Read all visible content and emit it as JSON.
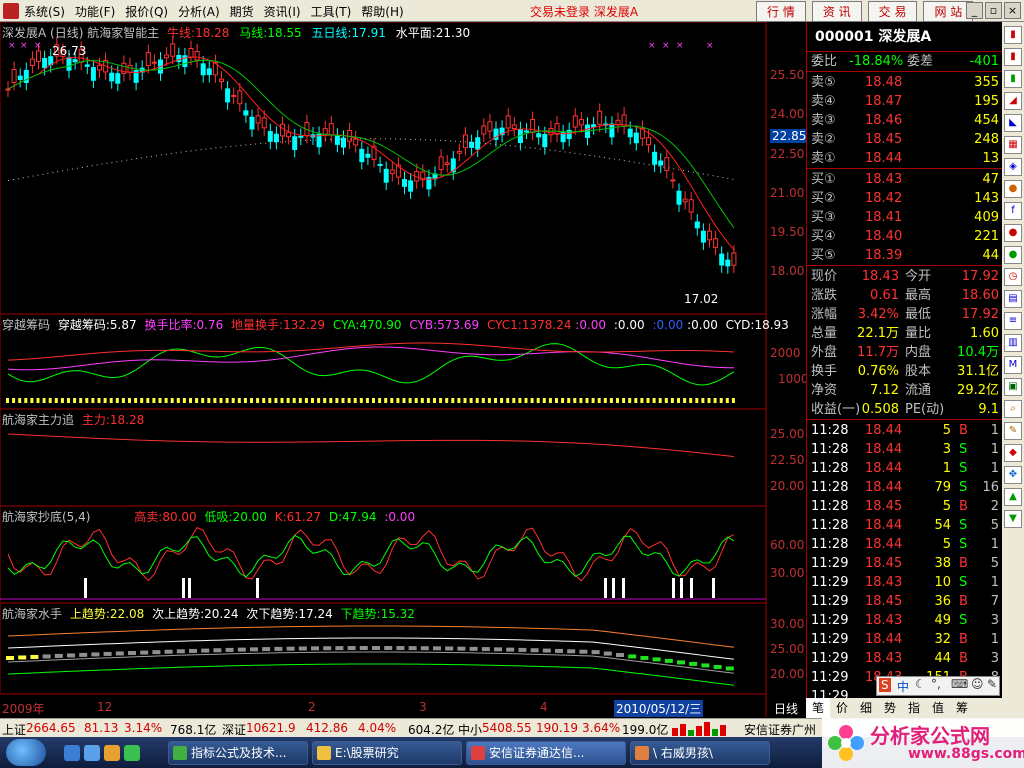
{
  "menubar": {
    "items": [
      "系统(S)",
      "功能(F)",
      "报价(Q)",
      "分析(A)",
      "期货",
      "资讯(I)",
      "工具(T)",
      "帮助(H)"
    ],
    "status": "交易未登录  深发展A",
    "buttons": [
      "行 情",
      "资 讯",
      "交 易",
      "网 站"
    ]
  },
  "chart": {
    "main_title": "深发展A (日线) 航海家智能主",
    "ma_labels": [
      "牛线:18.28",
      "马线:18.55",
      "五日线:17.91",
      "水平面:21.30"
    ],
    "high_label": "26.73",
    "low_label": "17.02",
    "price_marker": "22.85",
    "price_axis": [
      "25.50",
      "24.00",
      "22.50",
      "21.00",
      "19.50",
      "18.00"
    ],
    "p2_title": "穿越筹码",
    "p2_labels": [
      "穿越筹码:5.87",
      "换手比率:0.76",
      "地量换手:132.29",
      "CYA:470.90",
      "CYB:573.69",
      "CYC1:1378.24",
      ":0.00",
      ":0.00",
      ":0.00",
      ":0.00",
      "CYD:18.93"
    ],
    "p2_axis": [
      "2000",
      "1000"
    ],
    "p3_title": "航海家主力追",
    "p3_labels": [
      "主力:18.28"
    ],
    "p3_axis": [
      "25.00",
      "22.50",
      "20.00"
    ],
    "p4_title": "航海家抄底(5,4)",
    "p4_labels": [
      "高卖:80.00",
      "低吸:20.00",
      "K:61.27",
      "D:47.94",
      ":0.00"
    ],
    "p4_axis": [
      "60.00",
      "30.00"
    ],
    "p5_title": "航海家水手",
    "p5_labels": [
      "上趋势:22.08",
      "次上趋势:20.24",
      "次下趋势:17.24",
      "下趋势:15.32"
    ],
    "p5_axis": [
      "30.00",
      "25.00",
      "20.00"
    ],
    "xaxis": [
      "2009年",
      "12",
      "2",
      "3",
      "4"
    ],
    "date_box": "2010/05/12/三",
    "period": "日线"
  },
  "quote": {
    "code": "000001 深发展A",
    "webi_label": "委比",
    "webi_value": "-18.84%",
    "wecha_label": "委差",
    "wecha_value": "-401",
    "asks": [
      {
        "label": "卖⑤",
        "price": "18.48",
        "vol": "355"
      },
      {
        "label": "卖④",
        "price": "18.47",
        "vol": "195"
      },
      {
        "label": "卖③",
        "price": "18.46",
        "vol": "454"
      },
      {
        "label": "卖②",
        "price": "18.45",
        "vol": "248"
      },
      {
        "label": "卖①",
        "price": "18.44",
        "vol": "13"
      }
    ],
    "bids": [
      {
        "label": "买①",
        "price": "18.43",
        "vol": "47"
      },
      {
        "label": "买②",
        "price": "18.42",
        "vol": "143"
      },
      {
        "label": "买③",
        "price": "18.41",
        "vol": "409"
      },
      {
        "label": "买④",
        "price": "18.40",
        "vol": "221"
      },
      {
        "label": "买⑤",
        "price": "18.39",
        "vol": "44"
      }
    ],
    "stats": [
      {
        "l1": "现价",
        "v1": "18.43",
        "l2": "今开",
        "v2": "17.92"
      },
      {
        "l1": "涨跌",
        "v1": "0.61",
        "l2": "最高",
        "v2": "18.60"
      },
      {
        "l1": "涨幅",
        "v1": "3.42%",
        "l2": "最低",
        "v2": "17.92"
      },
      {
        "l1": "总量",
        "v1": "22.1万",
        "l2": "量比",
        "v2": "1.60"
      },
      {
        "l1": "外盘",
        "v1": "11.7万",
        "l2": "内盘",
        "v2": "10.4万"
      },
      {
        "l1": "换手",
        "v1": "0.76%",
        "l2": "股本",
        "v2": "31.1亿"
      },
      {
        "l1": "净资",
        "v1": "7.12",
        "l2": "流通",
        "v2": "29.2亿"
      },
      {
        "l1": "收益(一)",
        "v1": "0.508",
        "l2": "PE(动)",
        "v2": "9.1"
      }
    ],
    "ticks": [
      {
        "t": "11:28",
        "p": "18.44",
        "v": "5",
        "d": "B",
        "n": "1"
      },
      {
        "t": "11:28",
        "p": "18.44",
        "v": "3",
        "d": "S",
        "n": "1"
      },
      {
        "t": "11:28",
        "p": "18.44",
        "v": "1",
        "d": "S",
        "n": "1"
      },
      {
        "t": "11:28",
        "p": "18.44",
        "v": "79",
        "d": "S",
        "n": "16"
      },
      {
        "t": "11:28",
        "p": "18.45",
        "v": "5",
        "d": "B",
        "n": "2"
      },
      {
        "t": "11:28",
        "p": "18.44",
        "v": "54",
        "d": "S",
        "n": "5"
      },
      {
        "t": "11:28",
        "p": "18.44",
        "v": "5",
        "d": "S",
        "n": "1"
      },
      {
        "t": "11:29",
        "p": "18.45",
        "v": "38",
        "d": "B",
        "n": "5"
      },
      {
        "t": "11:29",
        "p": "18.43",
        "v": "10",
        "d": "S",
        "n": "1"
      },
      {
        "t": "11:29",
        "p": "18.45",
        "v": "36",
        "d": "B",
        "n": "7"
      },
      {
        "t": "11:29",
        "p": "18.43",
        "v": "49",
        "d": "S",
        "n": "3"
      },
      {
        "t": "11:29",
        "p": "18.44",
        "v": "32",
        "d": "B",
        "n": "1"
      },
      {
        "t": "11:29",
        "p": "18.43",
        "v": "44",
        "d": "B",
        "n": "3"
      },
      {
        "t": "11:29",
        "p": "18.43",
        "v": "151",
        "d": "B",
        "n": "8"
      },
      {
        "t": "11:29",
        "p": "",
        "v": "",
        "d": "",
        "n": ""
      }
    ],
    "tabs": [
      "笔",
      "价",
      "细",
      "势",
      "指",
      "值",
      "筹"
    ]
  },
  "statusbar": {
    "sh_label": "上证",
    "sh_val": "2664.65",
    "sh_chg": "81.13",
    "sh_pct": "3.14%",
    "sh_amt": "768.1亿",
    "sz_label": "深证",
    "sz_val": "10621.9",
    "sz_chg": "412.86",
    "sz_pct": "4.04%",
    "sz_amt": "604.2亿",
    "zx_label": "中小",
    "zx_val": "5408.55",
    "zx_chg": "190.19",
    "zx_pct": "3.64%",
    "zx_amt": "199.0亿",
    "broker": "安信证券广州"
  },
  "taskbar": {
    "tasks": [
      "指标公式及技术...",
      "E:\\股票研究",
      "安信证券通达信...",
      "\\ 右威男孩\\"
    ]
  },
  "watermark": {
    "title": "分析家公式网",
    "url": "www.88gs.com"
  },
  "ime": {
    "label": "中"
  },
  "colors": {
    "up": "#ff3232",
    "down": "#00ffff",
    "grid": "#a00000",
    "ma1": "#ff2020",
    "ma2": "#00c000",
    "yellow": "#ffff00"
  }
}
